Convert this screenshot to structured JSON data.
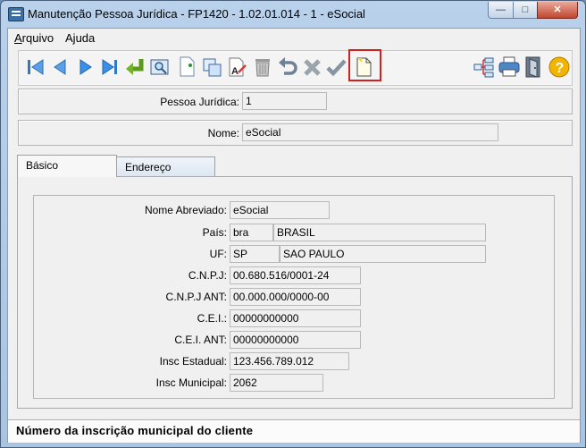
{
  "window": {
    "title": "Manutenção Pessoa Jurídica - FP1420 - 1.02.01.014 - 1 - eSocial",
    "controls": {
      "minimize": "—",
      "maximize": "□",
      "close": "✕"
    }
  },
  "menubar": {
    "items": [
      {
        "label": "Arquivo",
        "mnemonic": "A",
        "rest": "rquivo"
      },
      {
        "label": "Ajuda",
        "mnemonic": "j",
        "pre": "A",
        "rest": "uda"
      }
    ]
  },
  "toolbar": {
    "buttons": [
      "first-record-icon",
      "previous-record-icon",
      "next-record-icon",
      "last-record-icon",
      "go-to-icon",
      "search-icon",
      "new-record-icon",
      "copy-icon",
      "edit-icon",
      "delete-icon",
      "undo-icon",
      "cancel-icon",
      "confirm-icon",
      "new-document-icon",
      "relationship-icon",
      "print-icon",
      "exit-icon",
      "help-icon"
    ],
    "highlighted": "new-document-icon",
    "highlight_color": "#d02020"
  },
  "header": {
    "pessoa_juridica_label": "Pessoa Jurídica:",
    "pessoa_juridica_value": "1",
    "nome_label": "Nome:",
    "nome_value": "eSocial"
  },
  "tabs": [
    {
      "label": "Básico",
      "active": true
    },
    {
      "label": "Endereço",
      "active": false
    }
  ],
  "form": {
    "nome_abreviado_label": "Nome Abreviado:",
    "nome_abreviado_value": "eSocial",
    "pais_label": "País:",
    "pais_code": "bra",
    "pais_name": "BRASIL",
    "uf_label": "UF:",
    "uf_code": "SP",
    "uf_name": "SAO PAULO",
    "cnpj_label": "C.N.P.J:",
    "cnpj_value": "00.680.516/0001-24",
    "cnpj_ant_label": "C.N.P.J ANT:",
    "cnpj_ant_value": "00.000.000/0000-00",
    "cei_label": "C.E.I.:",
    "cei_value": "00000000000",
    "cei_ant_label": "C.E.I. ANT:",
    "cei_ant_value": "00000000000",
    "insc_estadual_label": "Insc Estadual:",
    "insc_estadual_value": "123.456.789.012",
    "insc_municipal_label": "Insc Municipal:",
    "insc_municipal_value": "2062"
  },
  "status": {
    "text": "Número da inscrição municipal do cliente"
  }
}
